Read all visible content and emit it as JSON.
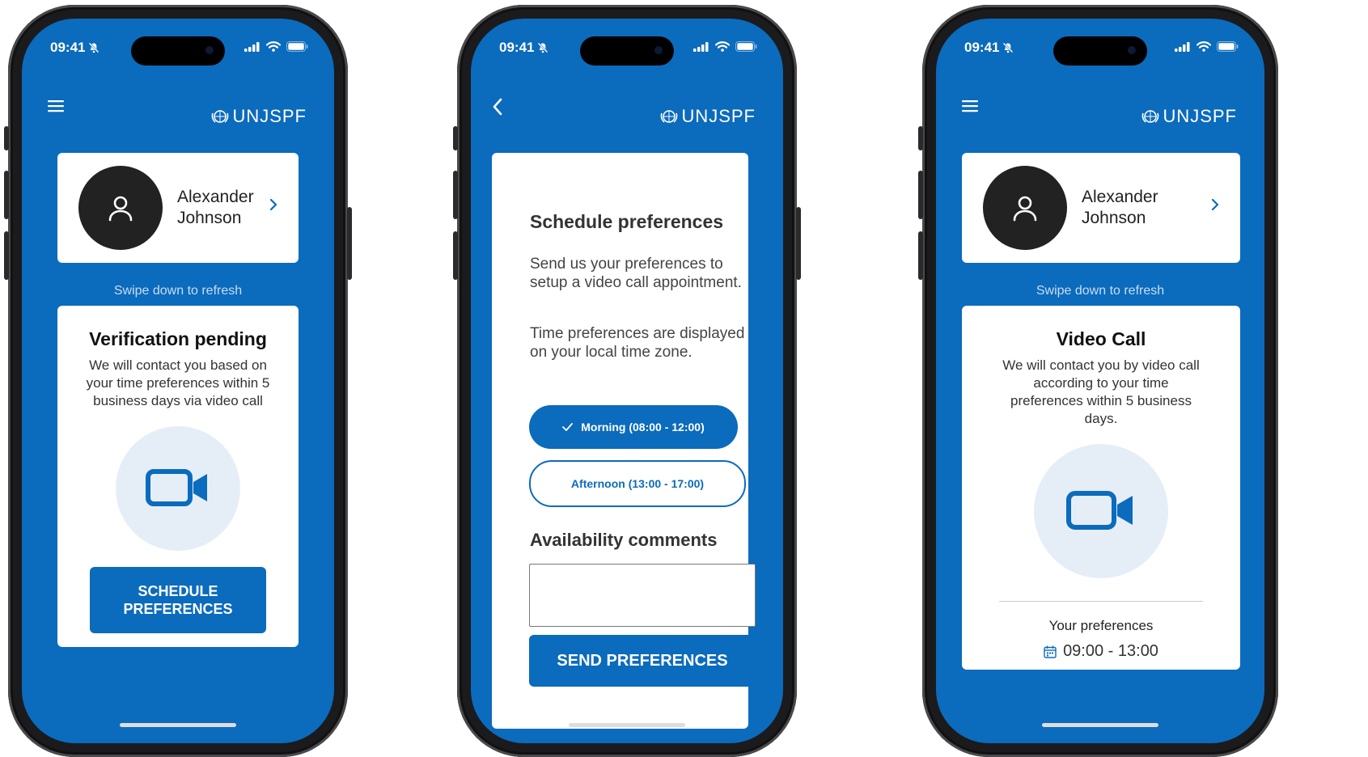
{
  "status_bar": {
    "time": "09:41"
  },
  "brand": {
    "name": "UNJSPF"
  },
  "profile": {
    "first_name": "Alexander",
    "last_name": "Johnson"
  },
  "refresh_hint": "Swipe down to refresh",
  "screen1": {
    "title": "Verification pending",
    "description": "We will contact you based on your time preferences within 5 business days via video call",
    "button_line1": "SCHEDULE",
    "button_line2": "PREFERENCES"
  },
  "screen2": {
    "title": "Schedule preferences",
    "intro": "Send us your preferences to setup a video call appointment.",
    "timezone_note": "Time preferences are displayed on your local time zone.",
    "options": [
      {
        "label": "Morning (08:00 - 12:00)",
        "selected": true
      },
      {
        "label": "Afternoon (13:00 - 17:00)",
        "selected": false
      }
    ],
    "comments_label": "Availability comments",
    "comments_value": "",
    "send_button": "SEND PREFERENCES"
  },
  "screen3": {
    "title": "Video Call",
    "description": "We will contact you by video call according to your time preferences within 5 business days.",
    "preferences_label": "Your preferences",
    "preferences_value": "09:00 - 13:00"
  },
  "colors": {
    "primary": "#0b6bbd",
    "light_circle": "#e5eef7"
  },
  "icons": [
    "menu-icon",
    "back-chevron-icon",
    "un-emblem-icon",
    "user-icon",
    "chevron-right-icon",
    "video-camera-icon",
    "calendar-icon",
    "check-icon",
    "bell-slash-icon",
    "signal-icon",
    "wifi-icon",
    "battery-icon"
  ]
}
